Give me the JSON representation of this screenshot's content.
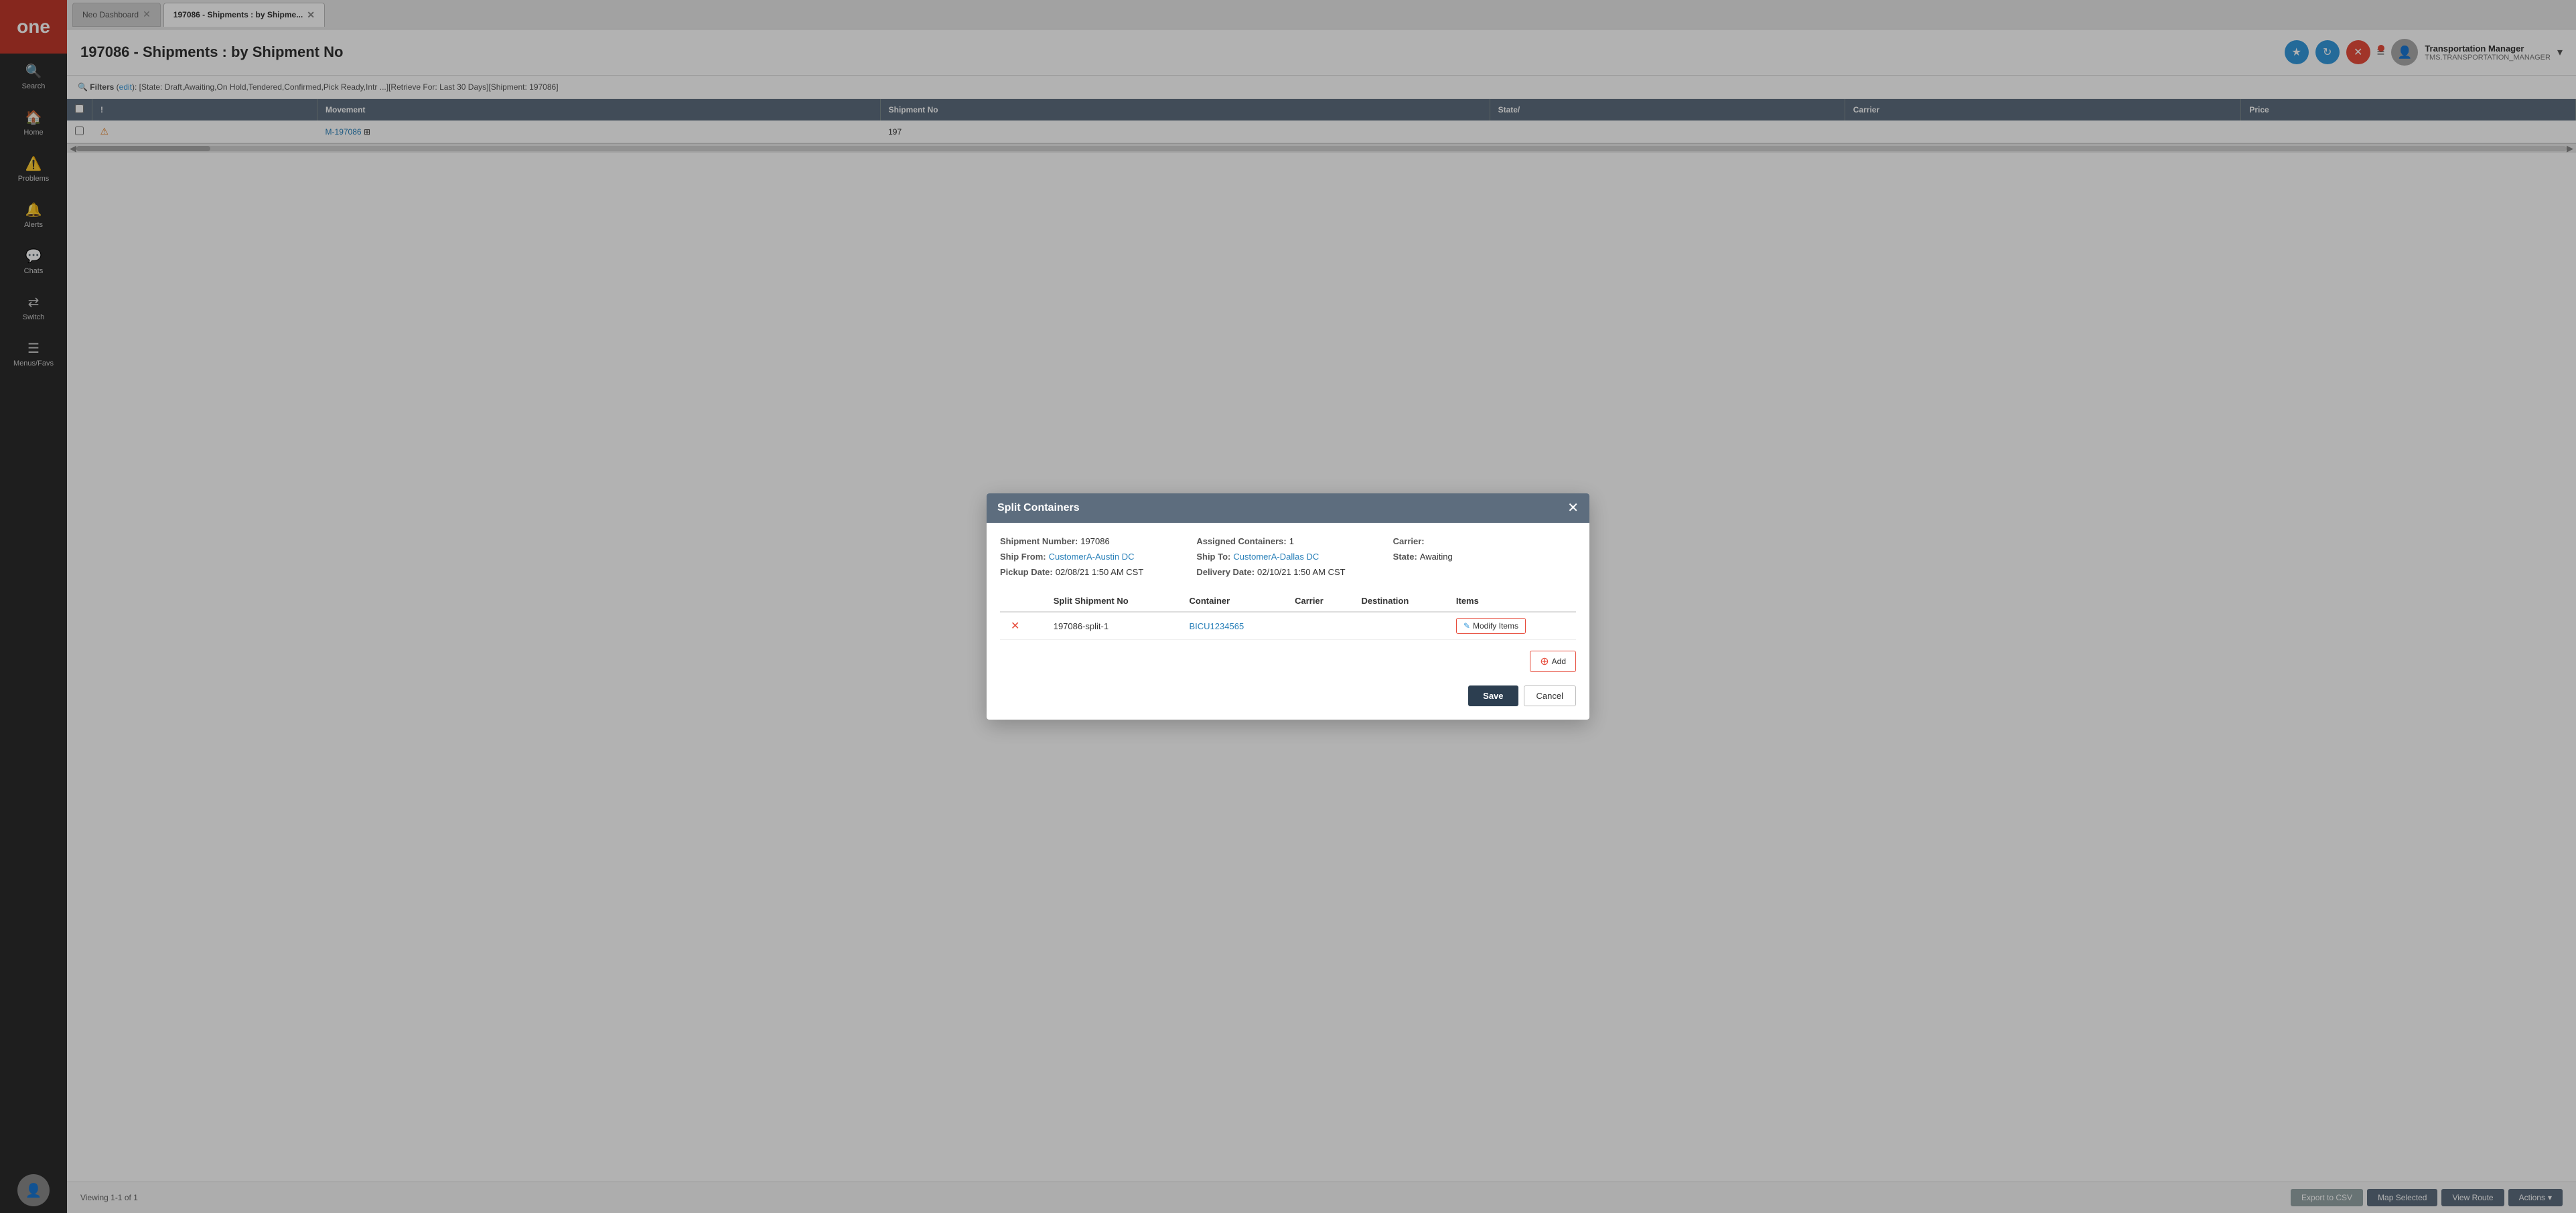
{
  "app": {
    "logo": "one"
  },
  "sidebar": {
    "items": [
      {
        "id": "search",
        "label": "Search",
        "icon": "🔍"
      },
      {
        "id": "home",
        "label": "Home",
        "icon": "🏠"
      },
      {
        "id": "problems",
        "label": "Problems",
        "icon": "⚠️"
      },
      {
        "id": "alerts",
        "label": "Alerts",
        "icon": "🔔"
      },
      {
        "id": "chats",
        "label": "Chats",
        "icon": "💬"
      },
      {
        "id": "switch",
        "label": "Switch",
        "icon": "🔄",
        "badge": "⇄"
      },
      {
        "id": "menus",
        "label": "Menus/Favs",
        "icon": "☰"
      }
    ],
    "avatar_icon": "👤"
  },
  "tabs": [
    {
      "id": "neo-dashboard",
      "label": "Neo Dashboard",
      "active": false,
      "closeable": true
    },
    {
      "id": "shipments",
      "label": "197086 - Shipments : by Shipme...",
      "active": true,
      "closeable": true
    }
  ],
  "header": {
    "title": "197086 - Shipments : by Shipment No",
    "buttons": {
      "star_label": "★",
      "refresh_label": "↻",
      "close_label": "✕",
      "menu_label": "≡"
    },
    "user": {
      "name": "Transportation Manager",
      "role": "TMS.TRANSPORTATION_MANAGER"
    }
  },
  "filter_bar": {
    "prefix": "Filters",
    "edit_label": "edit",
    "text": "[State: Draft,Awaiting,On Hold,Tendered,Confirmed,Pick Ready,Intr ...][Retrieve For: Last 30 Days][Shipment: 197086]"
  },
  "table": {
    "columns": [
      "",
      "!",
      "Movement",
      "Shipment No",
      "State/",
      "Carrier",
      "Price"
    ],
    "rows": [
      {
        "checked": false,
        "warning": true,
        "movement": "M-197086",
        "shipment_no": "197",
        "state": "",
        "carrier": "",
        "price": ""
      }
    ]
  },
  "footer": {
    "viewing_text": "Viewing 1-1 of 1",
    "buttons": [
      {
        "id": "export",
        "label": "Export to CSV"
      },
      {
        "id": "map",
        "label": "Map Selected"
      },
      {
        "id": "route",
        "label": "View Route"
      },
      {
        "id": "actions",
        "label": "Actions"
      }
    ]
  },
  "modal": {
    "title": "Split Containers",
    "close_label": "✕",
    "info": {
      "shipment_number_label": "Shipment Number:",
      "shipment_number": "197086",
      "assigned_containers_label": "Assigned Containers:",
      "assigned_containers": "1",
      "carrier_label": "Carrier:",
      "carrier_value": "",
      "ship_from_label": "Ship From:",
      "ship_from": "CustomerA-Austin DC",
      "ship_to_label": "Ship To:",
      "ship_to": "CustomerA-Dallas DC",
      "state_label": "State:",
      "state_value": "Awaiting",
      "pickup_date_label": "Pickup Date:",
      "pickup_date": "02/08/21 1:50 AM CST",
      "delivery_date_label": "Delivery Date:",
      "delivery_date": "02/10/21 1:50 AM CST"
    },
    "table": {
      "columns": [
        "",
        "Split Shipment No",
        "Container",
        "Carrier",
        "Destination",
        "Items"
      ],
      "rows": [
        {
          "split_no": "197086-split-1",
          "container": "BICU1234565",
          "carrier": "",
          "destination": "",
          "items_label": "Modify Items"
        }
      ]
    },
    "add_label": "+ Add",
    "add_icon": "⊕",
    "save_label": "Save",
    "cancel_label": "Cancel"
  }
}
